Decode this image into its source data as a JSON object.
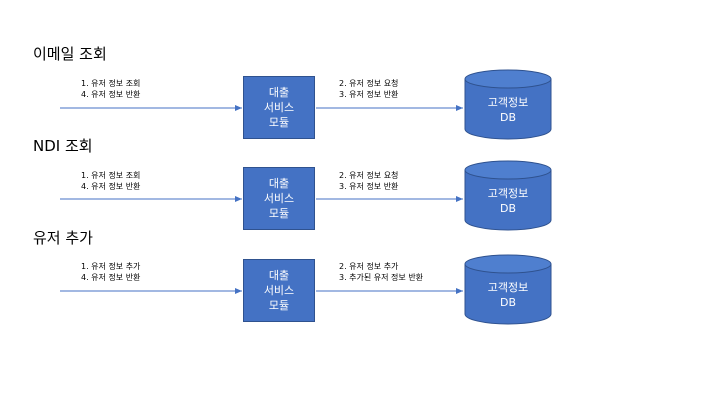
{
  "sections": [
    {
      "title": "이메일 조회",
      "left_steps": [
        "1.  유저 정보 조회",
        "4.  유저 정보 반환"
      ],
      "module_lines": [
        "대출",
        "서비스",
        "모듈"
      ],
      "right_steps": [
        "2. 유저 정보 요청",
        "3. 유저 정보 반환"
      ],
      "db_lines": [
        "고객정보",
        "DB"
      ]
    },
    {
      "title": "NDI 조회",
      "left_steps": [
        "1.  유저 정보 조회",
        "4.  유저 정보 반환"
      ],
      "module_lines": [
        "대출",
        "서비스",
        "모듈"
      ],
      "right_steps": [
        "2. 유저 정보 요청",
        "3. 유저 정보 반환"
      ],
      "db_lines": [
        "고객정보",
        "DB"
      ]
    },
    {
      "title": "유저 추가",
      "left_steps": [
        "1.  유저 정보 추가",
        "4.  유저 정보 반환"
      ],
      "module_lines": [
        "대출",
        "서비스",
        "모듈"
      ],
      "right_steps": [
        "2. 유저 정보 추가",
        "3. 추가된 유저 정보 반환"
      ],
      "db_lines": [
        "고객정보",
        "DB"
      ]
    }
  ],
  "colors": {
    "module_fill": "#4472c4",
    "module_border": "#2f528f",
    "arrow": "#4472c4",
    "db_fill": "#4472c4"
  }
}
